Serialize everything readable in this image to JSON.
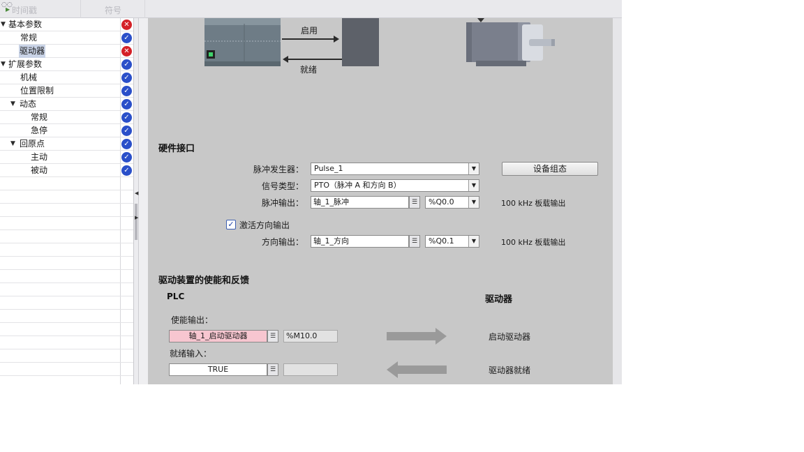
{
  "header": {
    "col1": "时间戳",
    "col2": "符号"
  },
  "tree": {
    "items": [
      {
        "label": "基本参数",
        "status": "error",
        "expanded": true
      },
      {
        "label": "常规",
        "status": "ok"
      },
      {
        "label": "驱动器",
        "status": "error",
        "selected": true
      },
      {
        "label": "扩展参数",
        "status": "ok",
        "expanded": true
      },
      {
        "label": "机械",
        "status": "ok"
      },
      {
        "label": "位置限制",
        "status": "ok"
      },
      {
        "label": "动态",
        "status": "ok",
        "expanded": true
      },
      {
        "label": "常规",
        "status": "ok"
      },
      {
        "label": "急停",
        "status": "ok"
      },
      {
        "label": "回原点",
        "status": "ok",
        "expanded": true
      },
      {
        "label": "主动",
        "status": "ok"
      },
      {
        "label": "被动",
        "status": "ok"
      }
    ]
  },
  "diagram": {
    "enable_label": "启用",
    "ready_label": "就绪"
  },
  "hardware": {
    "title": "硬件接口",
    "pulse_gen_label": "脉冲发生器：",
    "pulse_gen_value": "Pulse_1",
    "device_config_button": "设备组态",
    "signal_type_label": "信号类型：",
    "signal_type_value": "PTO（脉冲 A 和方向 B）",
    "pulse_out_label": "脉冲输出：",
    "pulse_out_tag": "轴_1_脉冲",
    "pulse_out_addr": "%Q0.0",
    "pulse_out_note": "100 kHz 板载输出",
    "dir_enable_label": "激活方向输出",
    "dir_enable_checked": true,
    "dir_out_label": "方向输出：",
    "dir_out_tag": "轴_1_方向",
    "dir_out_addr": "%Q0.1",
    "dir_out_note": "100 kHz 板载输出"
  },
  "enable_section": {
    "title": "驱动装置的使能和反馈",
    "plc_header": "PLC",
    "drive_header": "驱动器",
    "enable_out_label": "使能输出：",
    "enable_out_tag": "轴_1_启动驱动器",
    "enable_out_addr": "%M10.0",
    "enable_drive_label": "启动驱动器",
    "ready_in_label": "就绪输入：",
    "ready_in_tag": "TRUE",
    "ready_in_addr": "",
    "drive_ready_label": "驱动器就绪"
  },
  "colors": {
    "panel_bg": "#c8c8c8",
    "ok_badge": "#2a4fc9",
    "error_badge": "#d42027",
    "selected_row": "#c9d3e6",
    "tag_pink": "#f7c6d0"
  }
}
